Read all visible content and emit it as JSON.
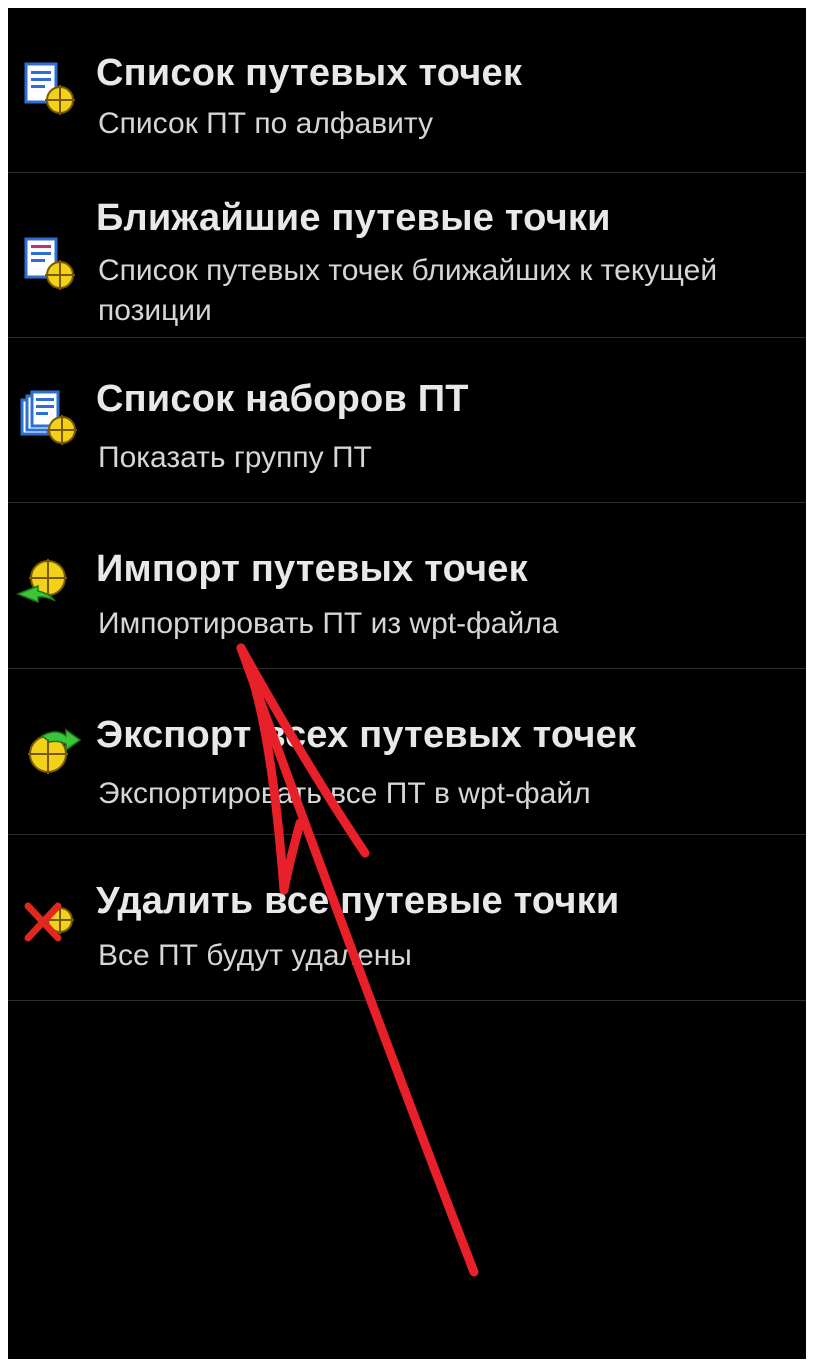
{
  "menu": {
    "items": [
      {
        "title": "Список путевых точек",
        "subtitle": "Список ПТ по алфавиту",
        "icon": "waypoint-list-icon"
      },
      {
        "title": "Ближайшие путевые точки",
        "subtitle": "Список путевых точек ближайших к текущей позиции",
        "icon": "nearest-waypoints-icon"
      },
      {
        "title": "Список наборов ПТ",
        "subtitle": "Показать группу ПТ",
        "icon": "waypoint-sets-icon"
      },
      {
        "title": "Импорт путевых точек",
        "subtitle": "Импортировать ПТ из wpt-файла",
        "icon": "import-icon"
      },
      {
        "title": "Экспорт всех путевых точек",
        "subtitle": "Экспортировать все ПТ в wpt-файл",
        "icon": "export-icon"
      },
      {
        "title": "Удалить все путевые точки",
        "subtitle": "Все ПТ будут удалены",
        "icon": "delete-all-icon"
      }
    ]
  },
  "colors": {
    "background": "#000000",
    "title": "#e8e8e8",
    "subtitle": "#d6d6d6",
    "divider": "#2c2c2c",
    "annotation": "#e8202a",
    "waypoint_marker": "#f2d11a",
    "icon_blue": "#2f6fd1",
    "icon_green": "#3cc43a",
    "icon_red": "#e0281c"
  }
}
